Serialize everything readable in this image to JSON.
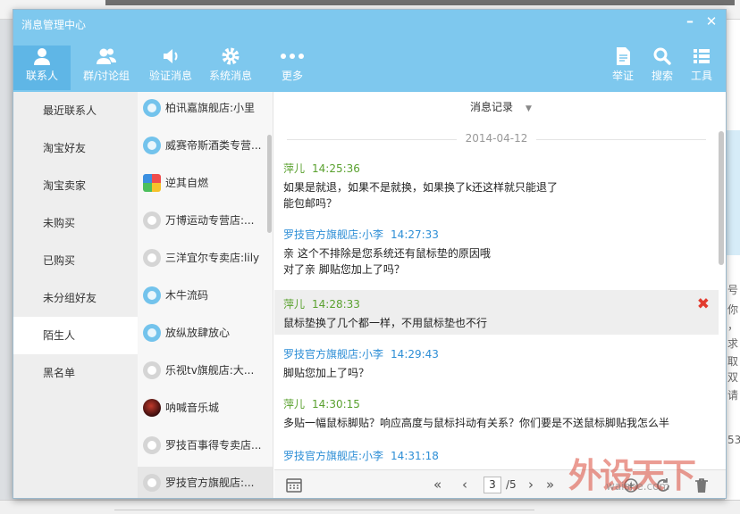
{
  "window": {
    "title": "消息管理中心",
    "minimize": "–",
    "close": "✕"
  },
  "toolbar": {
    "left": [
      {
        "label": "联系人",
        "icon": "person-icon"
      },
      {
        "label": "群/讨论组",
        "icon": "group-icon"
      },
      {
        "label": "验证消息",
        "icon": "speaker-icon"
      },
      {
        "label": "系统消息",
        "icon": "gear-icon"
      },
      {
        "label": "更多",
        "icon": "more-dots-icon"
      }
    ],
    "right": [
      {
        "label": "举证",
        "icon": "document-icon"
      },
      {
        "label": "搜索",
        "icon": "search-icon"
      },
      {
        "label": "工具",
        "icon": "list-icon"
      }
    ]
  },
  "categories": [
    "最近联系人",
    "淘宝好友",
    "淘宝卖家",
    "未购买",
    "已购买",
    "未分组好友",
    "陌生人",
    "黑名单"
  ],
  "contacts": [
    {
      "name": "柏讯嘉旗舰店:小里"
    },
    {
      "name": "威赛帝斯酒类专营..."
    },
    {
      "name": "逆其自燃"
    },
    {
      "name": "万博运动专营店:..."
    },
    {
      "name": "三洋宜尔专卖店:lily"
    },
    {
      "name": "木牛流码"
    },
    {
      "name": "放纵放肆放心"
    },
    {
      "name": "乐视tv旗舰店:大..."
    },
    {
      "name": "呐喊音乐城"
    },
    {
      "name": "罗技百事得专卖店..."
    },
    {
      "name": "罗技官方旗舰店:..."
    }
  ],
  "messages_panel": {
    "header": "消息记录",
    "header_arrow": "▼",
    "date": "2014-04-12",
    "delete_mark": "✖",
    "messages": [
      {
        "sender": "萍儿",
        "time": "14:25:36",
        "lines": [
          "如果是就退，如果不是就换，如果换了k还这样就只能退了",
          "能包邮吗？"
        ]
      },
      {
        "sender": "罗技官方旗舰店:小李",
        "time": "14:27:33",
        "lines": [
          "亲  这个不排除是您系统还有鼠标垫的原因哦",
          "对了亲 脚贴您加上了吗？"
        ]
      },
      {
        "sender": "萍儿",
        "time": "14:28:33",
        "lines": [
          "鼠标垫换了几个都一样，不用鼠标垫也不行"
        ]
      },
      {
        "sender": "罗技官方旗舰店:小李",
        "time": "14:29:43",
        "lines": [
          "脚贴您加上了吗？"
        ]
      },
      {
        "sender": "萍儿",
        "time": "14:30:15",
        "lines": [
          "多贴一幅鼠标脚贴？响应高度与鼠标抖动有关系？你们要是不送鼠标脚贴我怎么半"
        ]
      },
      {
        "sender": "罗技官方旗舰店:小李",
        "time": "14:31:18",
        "lines": []
      }
    ]
  },
  "pager": {
    "first": "«",
    "prev": "‹",
    "current": "3",
    "total": "/5",
    "next": "›",
    "last": "»"
  },
  "watermark": {
    "text": "外设天下",
    "url": "waishe.com"
  },
  "background_window": {
    "right_chars": [
      "号",
      "你",
      "，",
      "求",
      "取",
      "双",
      "请",
      "53"
    ]
  },
  "colors": {
    "titlebar": "#7ec8ee",
    "self_sender": "#5aa12f",
    "shop_sender": "#2d8ed6",
    "delete": "#e23b2e"
  }
}
